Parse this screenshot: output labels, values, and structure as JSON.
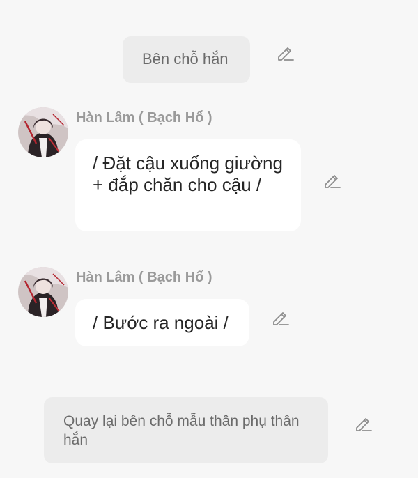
{
  "messages": [
    {
      "kind": "narration",
      "text": "Bên chỗ hắn"
    },
    {
      "kind": "character",
      "sender": "Hàn Lâm ( Bạch Hổ )",
      "text": "/ Đặt cậu xuống giường + đắp chăn cho cậu /"
    },
    {
      "kind": "character",
      "sender": "Hàn Lâm ( Bạch Hổ )",
      "text": "/ Bước ra ngoài /"
    },
    {
      "kind": "narration",
      "text": "Quay lại bên chỗ mẫu thân phụ thân hắn"
    }
  ],
  "icons": {
    "edit": "pencil-edit-icon",
    "avatar": "character-avatar-image"
  },
  "colors": {
    "background": "#f7f7f7",
    "narration_bubble": "#ececec",
    "message_bubble": "#ffffff",
    "sender_name": "#9a9a9a",
    "message_text": "#262626",
    "narration_text": "#6b6b6b"
  }
}
